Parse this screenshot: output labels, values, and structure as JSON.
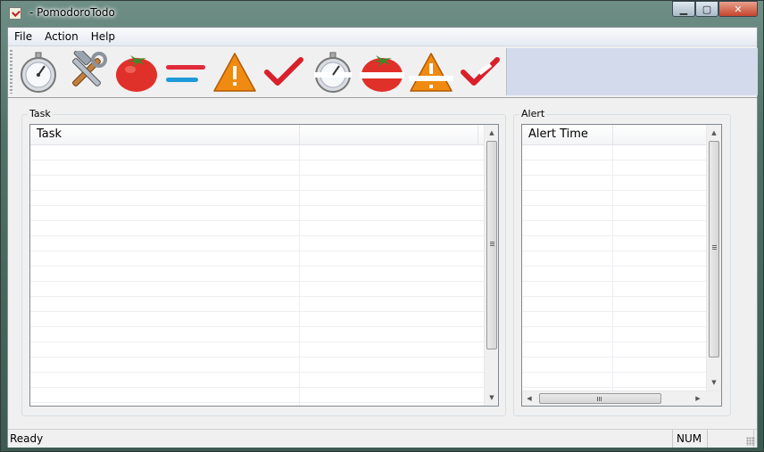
{
  "window": {
    "title": " - PomodoroTodo",
    "min_label": "▁",
    "max_label": "▢",
    "close_label": "✕"
  },
  "menu": {
    "file": "File",
    "action": "Action",
    "help": "Help"
  },
  "toolbar": {
    "buttons": [
      {
        "icon": "stopwatch-icon",
        "enabled": true
      },
      {
        "icon": "tools-icon",
        "enabled": true
      },
      {
        "icon": "tomato-icon",
        "enabled": true
      },
      {
        "icon": "priority-lines-icon",
        "enabled": true
      },
      {
        "icon": "warning-icon",
        "enabled": true
      },
      {
        "icon": "checkmark-icon",
        "enabled": true
      },
      {
        "icon": "stopwatch-stop-icon",
        "enabled": true
      },
      {
        "icon": "tomato-stop-icon",
        "enabled": true
      },
      {
        "icon": "warning-stop-icon",
        "enabled": true
      },
      {
        "icon": "checkmark-stop-icon",
        "enabled": true
      }
    ]
  },
  "task_panel": {
    "group_label": "Task",
    "columns": [
      "Task",
      ""
    ],
    "rows": []
  },
  "alert_panel": {
    "group_label": "Alert",
    "columns": [
      "Alert Time",
      ""
    ],
    "rows": []
  },
  "statusbar": {
    "status": "Ready",
    "num": "NUM"
  },
  "colors": {
    "menubar": "#e6ebf3",
    "toolbar_fill": "#d3daec",
    "tomato": "#e0302a",
    "warning": "#f08a10",
    "check": "#d9202a"
  }
}
